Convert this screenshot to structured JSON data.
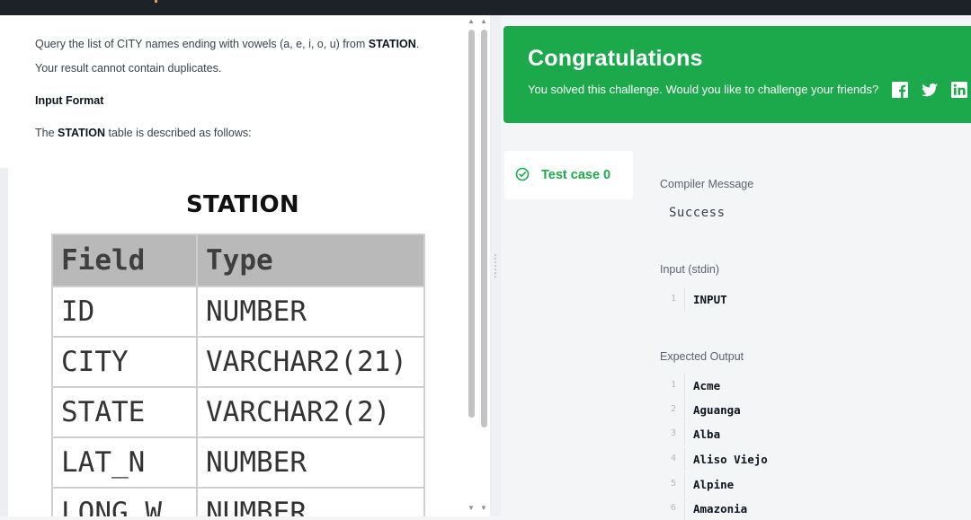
{
  "problem": {
    "line1_pre": "Query the list of CITY names ending with vowels (a, e, i, o, u) from ",
    "line1_bold": "STATION",
    "line1_post": ".",
    "line2": "Your result cannot contain duplicates.",
    "input_format_heading": "Input Format",
    "line3_pre": "The ",
    "line3_bold": "STATION",
    "line3_post": " table is described as follows:"
  },
  "station_table": {
    "title": "STATION",
    "headers": [
      "Field",
      "Type"
    ],
    "rows": [
      [
        "ID",
        "NUMBER"
      ],
      [
        "CITY",
        "VARCHAR2(21)"
      ],
      [
        "STATE",
        "VARCHAR2(2)"
      ],
      [
        "LAT_N",
        "NUMBER"
      ],
      [
        "LONG_W",
        "NUMBER"
      ]
    ]
  },
  "result": {
    "banner_title": "Congratulations",
    "banner_message": "You solved this challenge. Would you like to challenge your friends?",
    "banner_color": "#1ba94c",
    "social_icons": [
      "facebook-icon",
      "twitter-icon",
      "linkedin-icon"
    ],
    "test_case_label": "Test case 0",
    "compiler_message_label": "Compiler Message",
    "compiler_message": "Success",
    "input_label": "Input (stdin)",
    "input_lines": [
      {
        "num": "1",
        "text": "INPUT"
      }
    ],
    "expected_output_label": "Expected Output",
    "expected_output_lines": [
      {
        "num": "1",
        "text": "Acme"
      },
      {
        "num": "2",
        "text": "Aguanga"
      },
      {
        "num": "3",
        "text": "Alba"
      },
      {
        "num": "4",
        "text": "Aliso Viejo"
      },
      {
        "num": "5",
        "text": "Alpine"
      },
      {
        "num": "6",
        "text": "Amazonia"
      }
    ]
  }
}
